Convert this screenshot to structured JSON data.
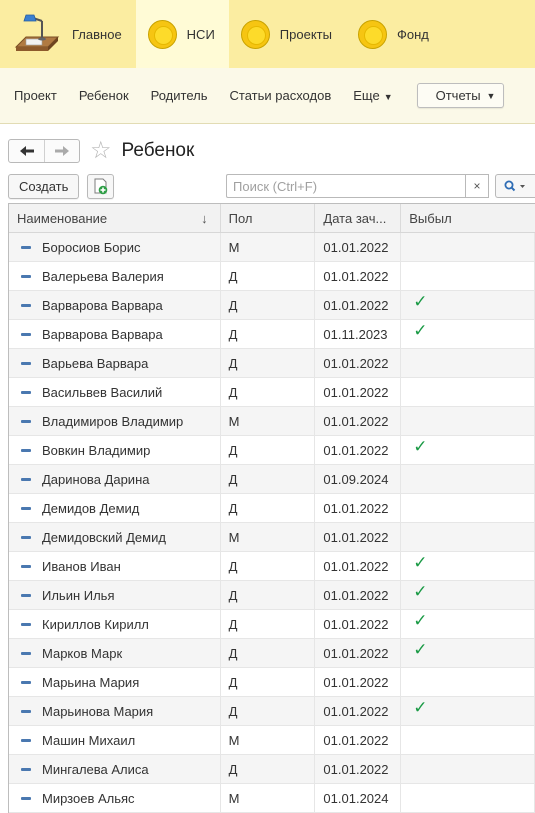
{
  "sections": [
    {
      "label": "Главное",
      "icon": "desk-lamp-icon",
      "active": false
    },
    {
      "label": "НСИ",
      "icon": "coin-icon",
      "active": true
    },
    {
      "label": "Проекты",
      "icon": "coin-icon",
      "active": false
    },
    {
      "label": "Фонд",
      "icon": "coin-icon",
      "active": false
    }
  ],
  "commands": {
    "project": "Проект",
    "child": "Ребенок",
    "parent": "Родитель",
    "expenses": "Статьи расходов",
    "more": "Еще",
    "reports": "Отчеты"
  },
  "form": {
    "title": "Ребенок",
    "back_icon": "arrow-left-icon",
    "forward_icon": "arrow-right-icon",
    "favorite_icon": "star-icon"
  },
  "toolbar": {
    "create_label": "Создать",
    "copy_icon": "copy-add-icon",
    "search_placeholder": "Поиск (Ctrl+F)",
    "clear_label": "×"
  },
  "table": {
    "columns": [
      "Наименование",
      "Пол",
      "Дата зач...",
      "Выбыл"
    ],
    "sort_indicator": "↓",
    "rows": [
      {
        "name": "Боросиов Борис",
        "gender": "М",
        "date": "01.01.2022",
        "left": false
      },
      {
        "name": "Валерьева Валерия",
        "gender": "Д",
        "date": "01.01.2022",
        "left": false
      },
      {
        "name": "Варварова Варвара",
        "gender": "Д",
        "date": "01.01.2022",
        "left": true
      },
      {
        "name": "Варварова Варвара",
        "gender": "Д",
        "date": "01.11.2023",
        "left": true
      },
      {
        "name": "Варьева Варвара",
        "gender": "Д",
        "date": "01.01.2022",
        "left": false
      },
      {
        "name": "Васильвев Василий",
        "gender": "Д",
        "date": "01.01.2022",
        "left": false
      },
      {
        "name": "Владимиров Владимир",
        "gender": "М",
        "date": "01.01.2022",
        "left": false
      },
      {
        "name": "Вовкин Владимир",
        "gender": "Д",
        "date": "01.01.2022",
        "left": true
      },
      {
        "name": "Даринова Дарина",
        "gender": "Д",
        "date": "01.09.2024",
        "left": false
      },
      {
        "name": "Демидов Демид",
        "gender": "Д",
        "date": "01.01.2022",
        "left": false
      },
      {
        "name": "Демидовский Демид",
        "gender": "М",
        "date": "01.01.2022",
        "left": false
      },
      {
        "name": "Иванов Иван",
        "gender": "Д",
        "date": "01.01.2022",
        "left": true
      },
      {
        "name": "Ильин Илья",
        "gender": "Д",
        "date": "01.01.2022",
        "left": true
      },
      {
        "name": "Кириллов Кирилл",
        "gender": "Д",
        "date": "01.01.2022",
        "left": true
      },
      {
        "name": "Марков Марк",
        "gender": "Д",
        "date": "01.01.2022",
        "left": true
      },
      {
        "name": "Марьина Мария",
        "gender": "Д",
        "date": "01.01.2022",
        "left": false
      },
      {
        "name": "Марьинова Мария",
        "gender": "Д",
        "date": "01.01.2022",
        "left": true
      },
      {
        "name": "Машин Михаил",
        "gender": "М",
        "date": "01.01.2022",
        "left": false
      },
      {
        "name": "Мингалева Алиса",
        "gender": "Д",
        "date": "01.01.2022",
        "left": false
      },
      {
        "name": "Мирзоев Альяс",
        "gender": "М",
        "date": "01.01.2024",
        "left": false
      }
    ]
  },
  "colors": {
    "section_bar": "#fbeda1",
    "active_section": "#fffbd6",
    "command_bar": "#fbf9e8",
    "check": "#1a9a45"
  }
}
